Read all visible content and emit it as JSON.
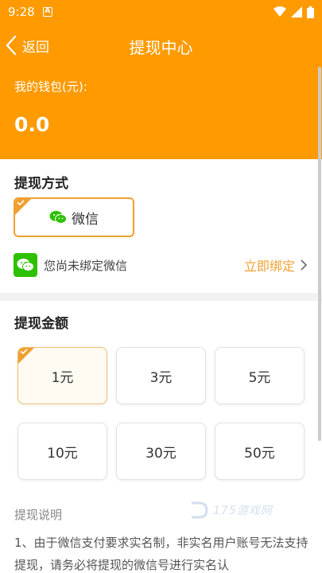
{
  "status_bar": {
    "time": "9:28",
    "notif_glyph": "A"
  },
  "nav": {
    "back_label": "返回",
    "title": "提现中心"
  },
  "wallet": {
    "label": "我的钱包(元):",
    "amount": "0.0"
  },
  "method": {
    "title": "提现方式",
    "option_label": "微信",
    "bind_prompt": "您尚未绑定微信",
    "bind_action": "立即绑定"
  },
  "amount": {
    "title": "提现金额",
    "options": [
      "1元",
      "3元",
      "5元",
      "10元",
      "30元",
      "50元"
    ],
    "selected_index": 0
  },
  "description": {
    "title": "提现说明",
    "text": "1、由于微信支付要求实名制，非实名用户账号无法支持提现，请务必将提现的微信号进行实名认"
  },
  "watermark": {
    "text": "175游戏网"
  },
  "colors": {
    "accent": "#ff9a00",
    "border_accent": "#f0a030",
    "wechat_green": "#2dc100"
  }
}
